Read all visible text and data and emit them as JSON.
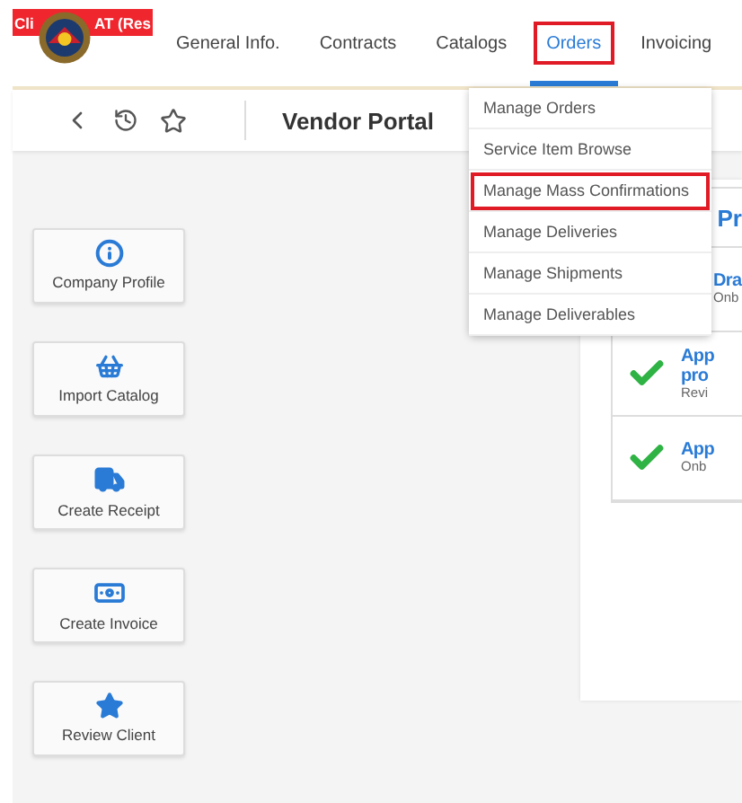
{
  "banner": {
    "text_parts": [
      "Cli",
      "AT (Res"
    ]
  },
  "nav": [
    {
      "label": "General Info.",
      "selected": false,
      "highlighted": false
    },
    {
      "label": "Contracts",
      "selected": false,
      "highlighted": false
    },
    {
      "label": "Catalogs",
      "selected": false,
      "highlighted": false
    },
    {
      "label": "Orders",
      "selected": true,
      "highlighted": true
    },
    {
      "label": "Invoicing",
      "selected": false,
      "highlighted": false
    }
  ],
  "toolbar": {
    "title": "Vendor Portal"
  },
  "orders_menu": [
    {
      "label": "Manage Orders",
      "highlighted": false
    },
    {
      "label": "Service Item Browse",
      "highlighted": false
    },
    {
      "label": "Manage Mass Confirmations",
      "highlighted": true
    },
    {
      "label": "Manage Deliveries",
      "highlighted": false
    },
    {
      "label": "Manage Shipments",
      "highlighted": false
    },
    {
      "label": "Manage Deliverables",
      "highlighted": false
    }
  ],
  "quick_actions": [
    {
      "label": "Company Profile",
      "kind": "info"
    },
    {
      "label": "Import Catalog",
      "kind": "basket"
    },
    {
      "label": "Create Receipt",
      "kind": "truck"
    },
    {
      "label": "Create Invoice",
      "kind": "money"
    },
    {
      "label": "Review Client",
      "kind": "star"
    }
  ],
  "panel": {
    "heading": "Pr",
    "rows": [
      {
        "done": false,
        "title_lines": [
          "Dra"
        ],
        "subtitle": "Onb"
      },
      {
        "done": true,
        "title_lines": [
          "App",
          "pro"
        ],
        "subtitle": "Revi"
      },
      {
        "done": true,
        "title_lines": [
          "App"
        ],
        "subtitle": "Onb"
      }
    ]
  }
}
